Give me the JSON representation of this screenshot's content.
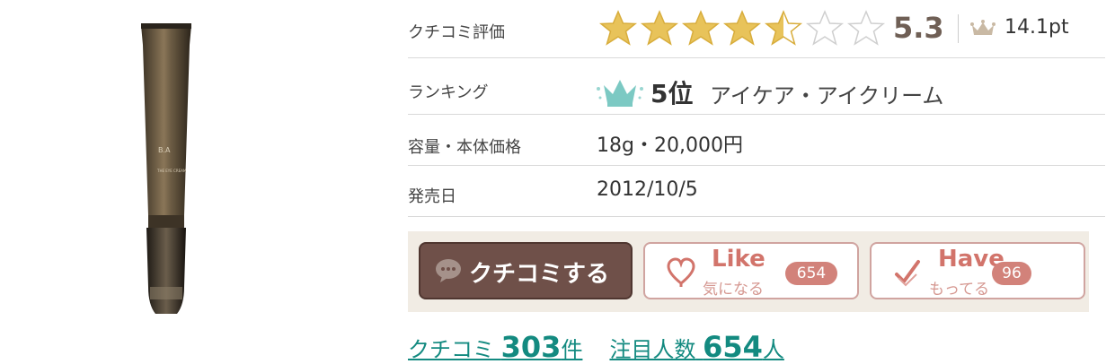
{
  "product": {
    "tube_labels": [
      "B.A",
      "THE EYE CREAM"
    ]
  },
  "rating": {
    "label": "クチコミ評価",
    "score": "5.3",
    "stars_total": 7,
    "stars_filled": 4.5,
    "points": "14.1pt"
  },
  "ranking": {
    "label": "ランキング",
    "rank": "5位",
    "category": "アイケア・アイクリーム"
  },
  "capacity": {
    "label": "容量・本体価格",
    "value": "18g・20,000円"
  },
  "release": {
    "label": "発売日",
    "value": "2012/10/5"
  },
  "buttons": {
    "review": "クチコミする",
    "like": {
      "label": "Like",
      "sub": "気になる",
      "count": "654"
    },
    "have": {
      "label": "Have",
      "sub": "もってる",
      "count": "96"
    }
  },
  "stats": {
    "review_prefix": "クチコミ",
    "review_count": "303",
    "review_suffix": "件",
    "attention_prefix": "注目人数",
    "attention_count": "654",
    "attention_suffix": "人"
  },
  "colors": {
    "star": "#e8c35a",
    "brand": "#6f5049",
    "accent": "#d2746b",
    "teal": "#138a80"
  }
}
